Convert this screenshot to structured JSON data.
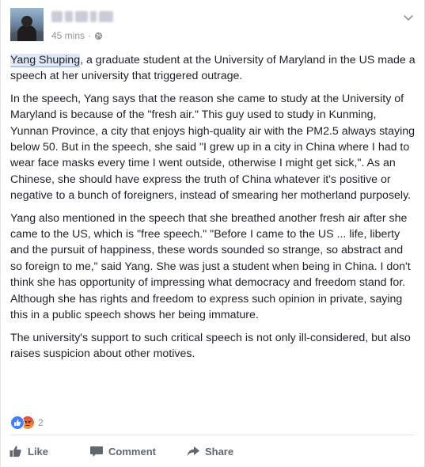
{
  "post": {
    "timestamp": "45 mins",
    "separator": "·",
    "privacy_icon": "globe-icon",
    "menu_icon": "chevron-down-icon",
    "highlight_name": "Yang Shuping",
    "paragraphs": [
      ", a graduate student at the University of Maryland in the US made a speech at her university that triggered outrage.",
      "In the speech, Yang says that the reason she came to study at the University of Maryland is because of the \"fresh air.\" This guy used to study in Kunming, Yunnan Province, a city that enjoys high-quality air with the PM2.5 always staying below 50. But in the speech, she said \"I grew up in a city in China where I had to wear face masks every time I went outside, otherwise I might get sick,\". As an Chinese, she should have express the truth of China whatever it's positive or negative to a bunch of foreigners, instead of smearing her motherland purposely.",
      "Yang also mentioned in the speech that she breathed another fresh air after she came to the US, which is \"free speech.\" \"Before I came to the US ... life, liberty and the pursuit of happiness, these words sounded so strange, so abstract and so foreign to me,\" said Yang. She was just a student when being in China. I don't think she has opportunity of impressing what democracy and freedom stand for. Although she has rights and freedom to express such opinion in private, saying this in a public speech shows her being immature.",
      "The university's support to such critical speech is not only ill-considered, but also raises suspicion about other motives."
    ]
  },
  "reactions": {
    "types": [
      "like-reaction-icon",
      "angry-reaction-icon"
    ],
    "count": "2"
  },
  "actions": {
    "like": "Like",
    "comment": "Comment",
    "share": "Share"
  },
  "colors": {
    "text": "#1d2129",
    "meta": "#90949c",
    "action": "#616770",
    "link_highlight": "#dfe7f5",
    "like_blue": "#4080ff"
  }
}
